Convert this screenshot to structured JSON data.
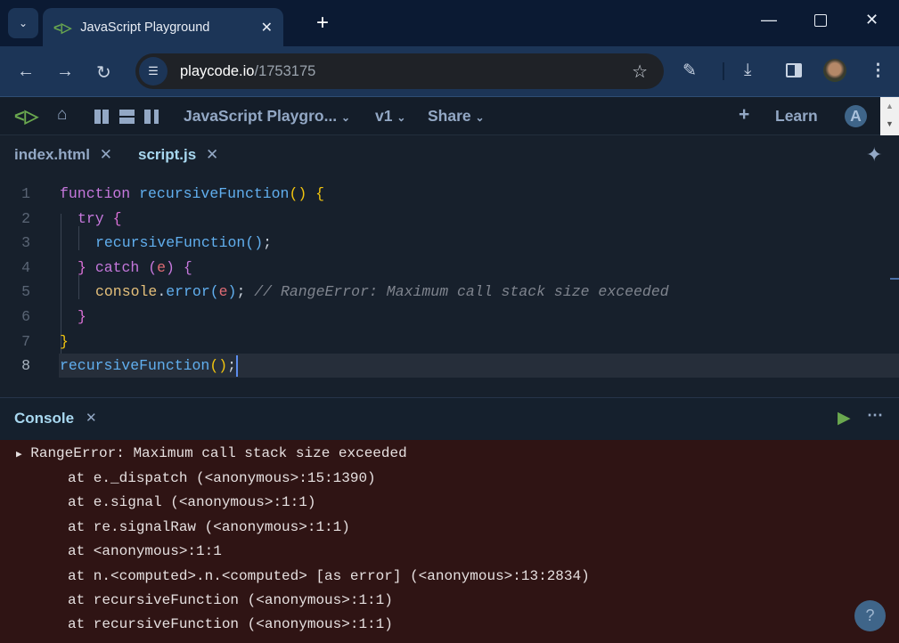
{
  "browser": {
    "tab_title": "JavaScript Playground",
    "url_host": "playcode.io",
    "url_path": "/1753175",
    "icons": [
      "chevron-down-icon",
      "playcode-logo-icon",
      "close-icon",
      "plus-icon",
      "minimize-icon",
      "maximize-icon",
      "close-window-icon",
      "back-icon",
      "forward-icon",
      "reload-icon",
      "site-info-icon",
      "star-icon",
      "extensions-icon",
      "download-icon",
      "side-panel-icon",
      "profile-avatar",
      "more-vert-icon"
    ]
  },
  "app_toolbar": {
    "project_name": "JavaScript Playgro...",
    "version": "v1",
    "share": "Share",
    "learn": "Learn",
    "user_initial": "A"
  },
  "file_tabs": [
    {
      "label": "index.html",
      "active": false
    },
    {
      "label": "script.js",
      "active": true
    }
  ],
  "colors": {
    "keyword": "#c678dd",
    "func": "#61afef",
    "paren": "#f1c40f",
    "brace2": "#da70d6",
    "var": "#e06c75",
    "obj": "#e5c07b",
    "comment": "#7f848e",
    "plain": "#c8d0da",
    "accent": "#6aa84f",
    "console_bg": "#2f1414"
  },
  "code_lines": [
    {
      "n": "1",
      "indent": 0,
      "tokens": [
        {
          "t": "function ",
          "c": "keyword"
        },
        {
          "t": "recursiveFunction",
          "c": "func"
        },
        {
          "t": "() {",
          "c": "paren"
        }
      ]
    },
    {
      "n": "2",
      "indent": 1,
      "tokens": [
        {
          "t": "try ",
          "c": "keyword"
        },
        {
          "t": "{",
          "c": "brace2"
        }
      ]
    },
    {
      "n": "3",
      "indent": 2,
      "tokens": [
        {
          "t": "recursiveFunction",
          "c": "func"
        },
        {
          "t": "()",
          "c": "func"
        },
        {
          "t": ";",
          "c": "plain"
        }
      ]
    },
    {
      "n": "4",
      "indent": 1,
      "tokens": [
        {
          "t": "} ",
          "c": "brace2"
        },
        {
          "t": "catch ",
          "c": "keyword"
        },
        {
          "t": "(",
          "c": "keyword"
        },
        {
          "t": "e",
          "c": "var"
        },
        {
          "t": ") {",
          "c": "keyword"
        }
      ]
    },
    {
      "n": "5",
      "indent": 2,
      "tokens": [
        {
          "t": "console",
          "c": "obj"
        },
        {
          "t": ".",
          "c": "plain"
        },
        {
          "t": "error",
          "c": "func"
        },
        {
          "t": "(",
          "c": "func"
        },
        {
          "t": "e",
          "c": "var"
        },
        {
          "t": ")",
          "c": "func"
        },
        {
          "t": "; ",
          "c": "plain"
        },
        {
          "t": "// RangeError: Maximum call stack size exceeded",
          "c": "comment"
        }
      ]
    },
    {
      "n": "6",
      "indent": 1,
      "tokens": [
        {
          "t": "}",
          "c": "brace2"
        }
      ]
    },
    {
      "n": "7",
      "indent": 0,
      "tokens": [
        {
          "t": "}",
          "c": "paren"
        }
      ]
    },
    {
      "n": "8",
      "indent": 0,
      "tokens": [
        {
          "t": "recursiveFunction",
          "c": "func"
        },
        {
          "t": "()",
          "c": "paren"
        },
        {
          "t": ";",
          "c": "plain"
        }
      ]
    }
  ],
  "console": {
    "title": "Console",
    "error_header": "RangeError: Maximum call stack size exceeded",
    "stack": [
      "at e._dispatch (<anonymous>:15:1390)",
      "at e.signal (<anonymous>:1:1)",
      "at re.signalRaw (<anonymous>:1:1)",
      "at <anonymous>:1:1",
      "at n.<computed>.n.<computed> [as error] (<anonymous>:13:2834)",
      "at recursiveFunction (<anonymous>:1:1)",
      "at recursiveFunction (<anonymous>:1:1)"
    ],
    "help": "?"
  }
}
